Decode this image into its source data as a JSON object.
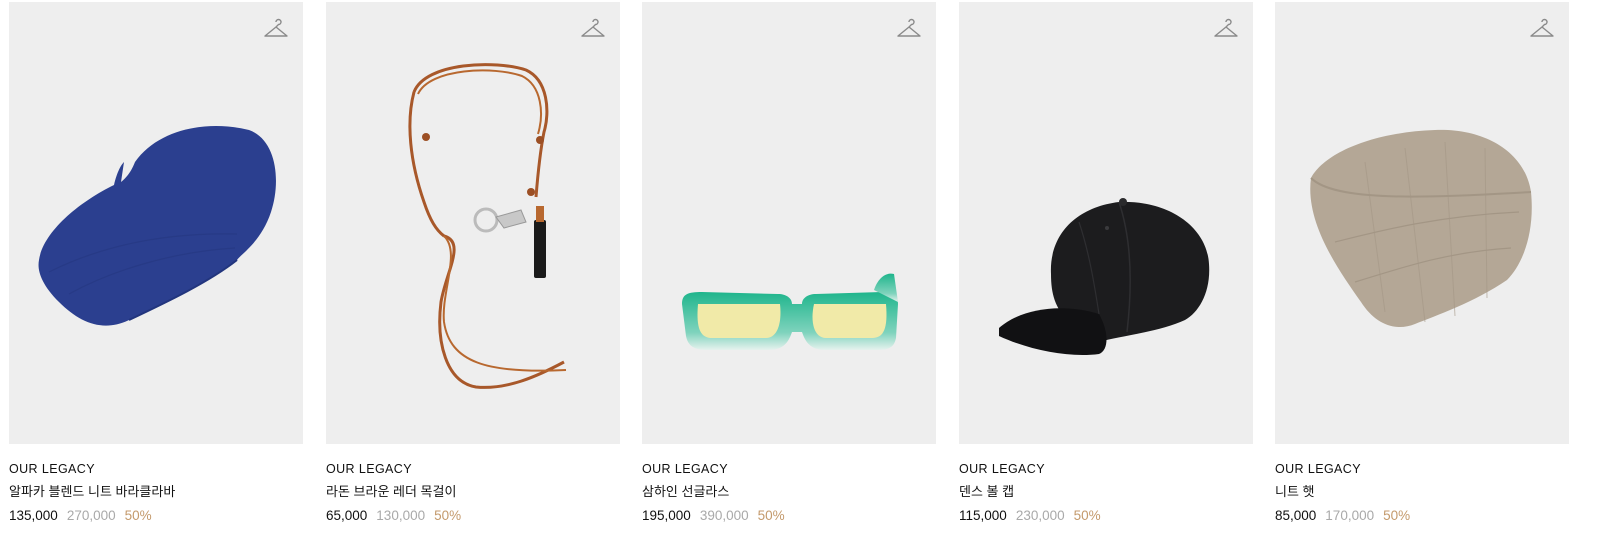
{
  "products": [
    {
      "brand": "OUR LEGACY",
      "name": "알파카 블렌드 니트 바라클라바",
      "price": "135,000",
      "original_price": "270,000",
      "discount": "50%",
      "image": "blue-balaclava",
      "wishlist_icon": "hanger-icon"
    },
    {
      "brand": "OUR LEGACY",
      "name": "라돈 브라운 레더 목걸이",
      "price": "65,000",
      "original_price": "130,000",
      "discount": "50%",
      "image": "brown-leather-necklace",
      "wishlist_icon": "hanger-icon"
    },
    {
      "brand": "OUR LEGACY",
      "name": "삼하인 선글라스",
      "price": "195,000",
      "original_price": "390,000",
      "discount": "50%",
      "image": "green-sunglasses",
      "wishlist_icon": "hanger-icon"
    },
    {
      "brand": "OUR LEGACY",
      "name": "덴스 볼 캡",
      "price": "115,000",
      "original_price": "230,000",
      "discount": "50%",
      "image": "black-ball-cap",
      "wishlist_icon": "hanger-icon"
    },
    {
      "brand": "OUR LEGACY",
      "name": "니트 햇",
      "price": "85,000",
      "original_price": "170,000",
      "discount": "50%",
      "image": "beige-knit-hat",
      "wishlist_icon": "hanger-icon"
    }
  ],
  "colors": {
    "card_bg": "#eeeeee",
    "original_price": "#a9a9a9",
    "discount": "#c49a6c",
    "text": "#111111"
  }
}
